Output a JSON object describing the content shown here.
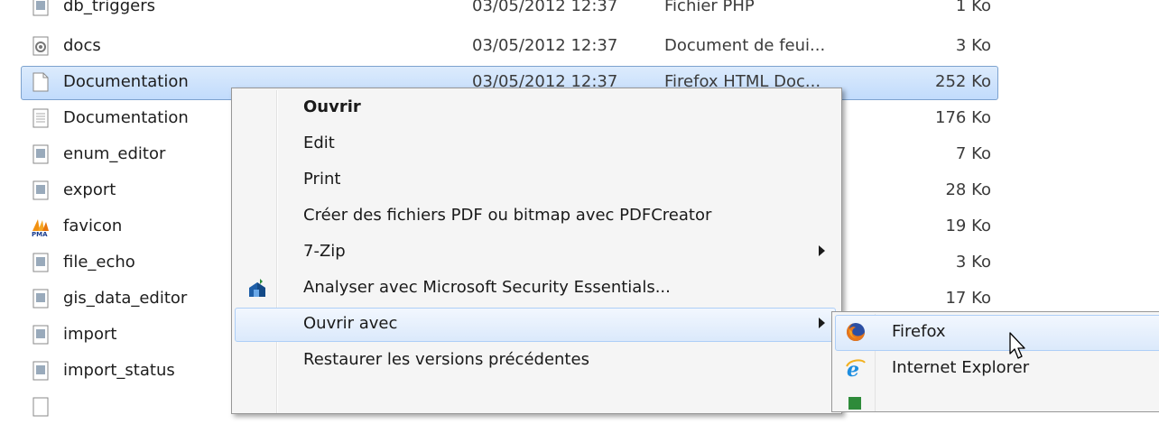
{
  "files": [
    {
      "name": "db_triggers",
      "date": "03/05/2012 12:37",
      "type": "Fichier PHP",
      "size": "1 Ko",
      "icon": "php-file-icon"
    },
    {
      "name": "docs",
      "date": "03/05/2012 12:37",
      "type": "Document de feui...",
      "size": "3 Ko",
      "icon": "css-file-icon"
    },
    {
      "name": "Documentation",
      "date": "03/05/2012 12:37",
      "type": "Firefox HTML Doc...",
      "size": "252 Ko",
      "icon": "blank-file-icon"
    },
    {
      "name": "Documentation",
      "size": "176 Ko",
      "icon": "text-file-icon"
    },
    {
      "name": "enum_editor",
      "size": "7 Ko",
      "icon": "php-file-icon"
    },
    {
      "name": "export",
      "size": "28 Ko",
      "icon": "php-file-icon"
    },
    {
      "name": "favicon",
      "size": "19 Ko",
      "icon": "pma-favicon-icon"
    },
    {
      "name": "file_echo",
      "size": "3 Ko",
      "icon": "php-file-icon"
    },
    {
      "name": "gis_data_editor",
      "size": "17 Ko",
      "icon": "php-file-icon"
    },
    {
      "name": "import",
      "icon": "php-file-icon"
    },
    {
      "name": "import_status",
      "icon": "php-file-icon"
    }
  ],
  "context_menu": {
    "items": [
      {
        "label": "Ouvrir",
        "bold": true
      },
      {
        "label": "Edit"
      },
      {
        "label": "Print"
      },
      {
        "label": "Créer des fichiers PDF ou bitmap avec PDFCreator"
      },
      {
        "label": "7-Zip",
        "submenu": true
      },
      {
        "label": "Analyser avec Microsoft Security Essentials...",
        "icon": "security-essentials-icon"
      },
      {
        "label": "Ouvrir avec",
        "submenu": true,
        "highlighted": true
      },
      {
        "label": "Restaurer les versions précédentes"
      }
    ]
  },
  "open_with_submenu": {
    "items": [
      {
        "label": "Firefox",
        "icon": "firefox-icon",
        "highlighted": true
      },
      {
        "label": "Internet Explorer",
        "icon": "internet-explorer-icon"
      }
    ]
  },
  "colors": {
    "selection_border": "#7da2ce",
    "hover_border": "#aecff7",
    "menu_background": "#f5f5f5"
  }
}
